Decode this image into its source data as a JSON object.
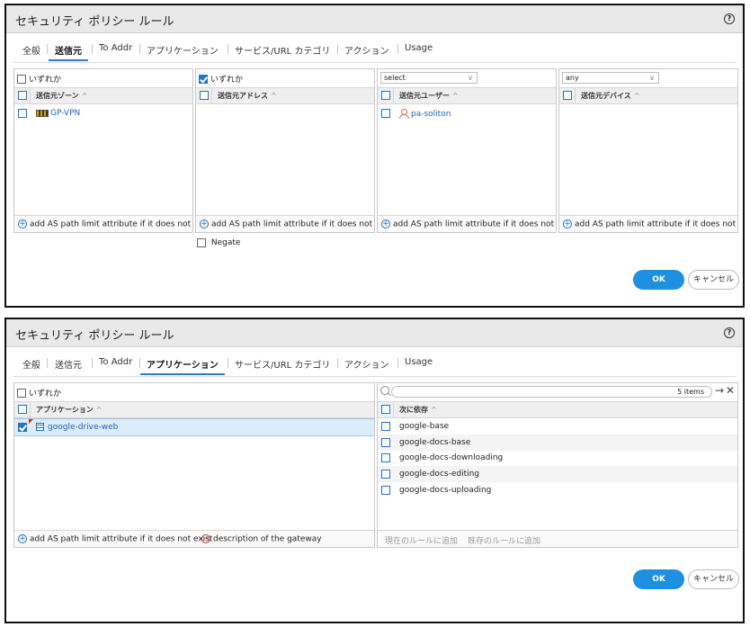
{
  "dialog1": {
    "title": "セキュリティ ポリシー ルール",
    "help": "?",
    "tabs": [
      "全般",
      "送信元",
      "To Addr",
      "アプリケーション",
      "サービス/URL カテゴリ",
      "アクション",
      "Usage"
    ],
    "active_tab": "送信元",
    "panel_zone": {
      "any_label": "いずれか",
      "any_checked": false,
      "header": "送信元ゾーン",
      "items": [
        "GP-VPN"
      ],
      "footer": "add AS path limit attribute if it does not exist"
    },
    "panel_address": {
      "any_label": "いずれか",
      "any_checked": true,
      "header": "送信元アドレス",
      "items": [],
      "footer": "add AS path limit attribute if it does not exist",
      "negate_label": "Negate"
    },
    "panel_user": {
      "select_value": "select",
      "header": "送信元ユーザー",
      "items": [
        "pa-soliton"
      ],
      "footer": "add AS path limit attribute if it does not exist"
    },
    "panel_device": {
      "select_value": "any",
      "header": "送信元デバイス",
      "items": [],
      "footer": "add AS path limit attribute if it does not exist"
    },
    "ok_label": "OK",
    "cancel_label": "キャンセル"
  },
  "dialog2": {
    "title": "セキュリティ ポリシー ルール",
    "help": "?",
    "tabs": [
      "全般",
      "送信元",
      "To Addr",
      "アプリケーション",
      "サービス/URL カテゴリ",
      "アクション",
      "Usage"
    ],
    "active_tab": "アプリケーション",
    "panel_app": {
      "any_label": "いずれか",
      "any_checked": false,
      "header": "アプリケーション",
      "items": [
        "google-drive-web"
      ],
      "footer_add": "add AS path limit attribute if it does not exist",
      "footer_remove": "description of the gateway"
    },
    "panel_depends": {
      "search_placeholder": "",
      "item_count": "5 items",
      "header": "次に依存",
      "items": [
        "google-base",
        "google-docs-base",
        "google-docs-downloading",
        "google-docs-editing",
        "google-docs-uploading"
      ],
      "footer_add_current": "現在のルールに追加",
      "footer_add_existing": "既存のルールに追加"
    },
    "ok_label": "OK",
    "cancel_label": "キャンセル"
  },
  "icons": {
    "help": "help-circle-icon",
    "zone": "zone-icon",
    "user": "user-icon",
    "app": "application-icon",
    "search": "search-icon",
    "arrow": "arrow-right-icon",
    "close": "close-icon",
    "add": "plus-circle-icon",
    "remove": "minus-circle-icon"
  },
  "colors": {
    "accent": "#1f73c8",
    "ok_button": "#1f8fe0",
    "link": "#1a66c2",
    "selected_row": "#dcecf8"
  }
}
